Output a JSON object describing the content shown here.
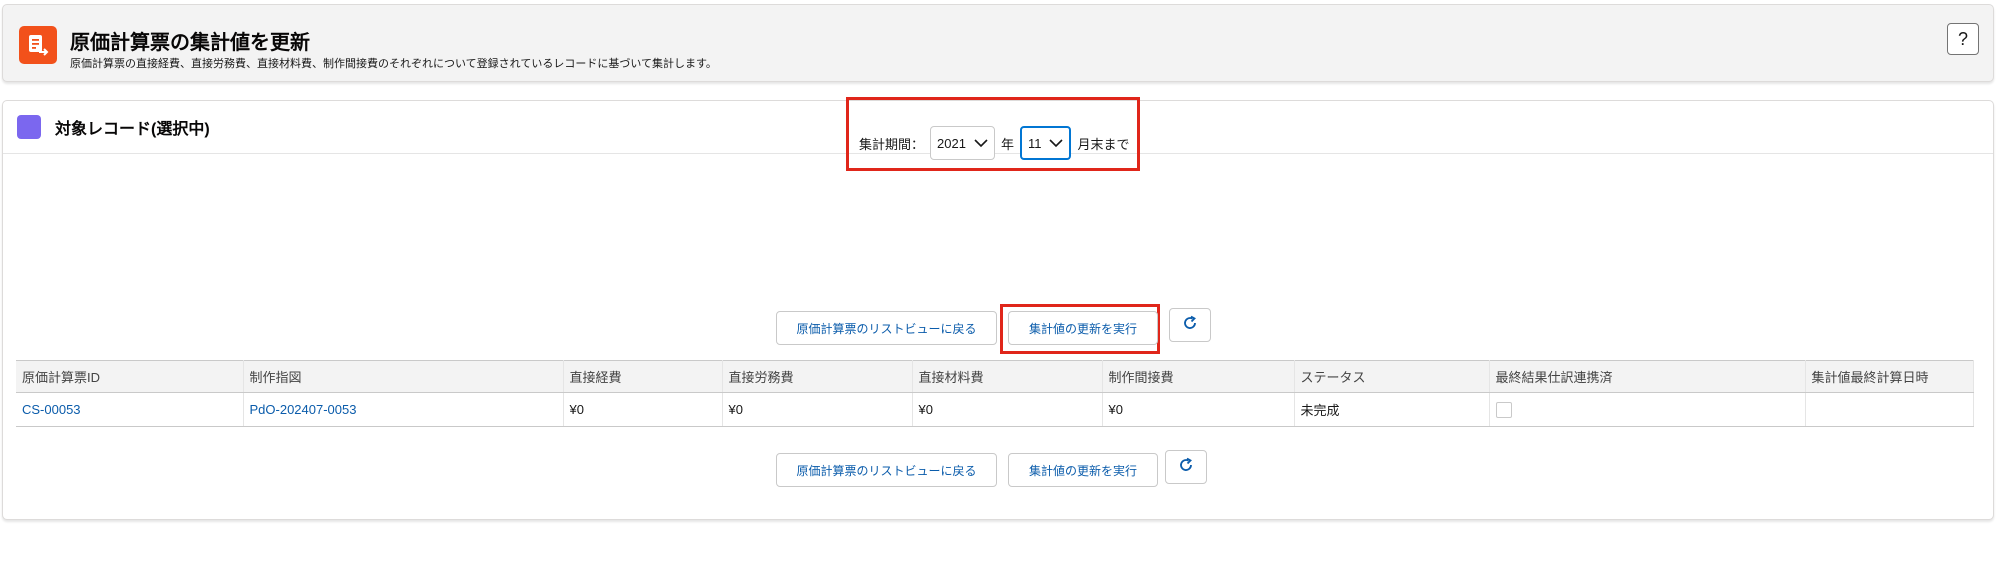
{
  "header": {
    "title": "原価計算票の集計値を更新",
    "subtitle": "原価計算票の直接経費、直接労務費、直接材料費、制作間接費のそれぞれについて登録されているレコードに基づいて集計します。",
    "help_label": "?",
    "icon": "document-arrow-icon",
    "icon_color": "#f2511b"
  },
  "card": {
    "title": "対象レコード(選択中)",
    "icon_color": "#7b67ef"
  },
  "period": {
    "label": "集計期間：",
    "year_value": "2021",
    "year_unit": "年",
    "month_value": "11",
    "month_suffix": "月末まで"
  },
  "actions": {
    "back_label": "原価計算票のリストビューに戻る",
    "run_label": "集計値の更新を実行",
    "refresh_icon": "refresh-icon"
  },
  "table": {
    "columns": [
      "原価計算票ID",
      "制作指図",
      "直接経費",
      "直接労務費",
      "直接材料費",
      "制作間接費",
      "ステータス",
      "最終結果仕訳連携済",
      "集計値最終計算日時"
    ],
    "rows": [
      {
        "id": "CS-00053",
        "order": "PdO-202407-0053",
        "direct_expense": "¥0",
        "direct_labor": "¥0",
        "direct_material": "¥0",
        "overhead": "¥0",
        "status": "未完成",
        "journal_linked": false,
        "last_calc": ""
      }
    ]
  },
  "colors": {
    "highlight": "#e0261a",
    "link": "#0b5cab",
    "focus": "#0176d3"
  }
}
